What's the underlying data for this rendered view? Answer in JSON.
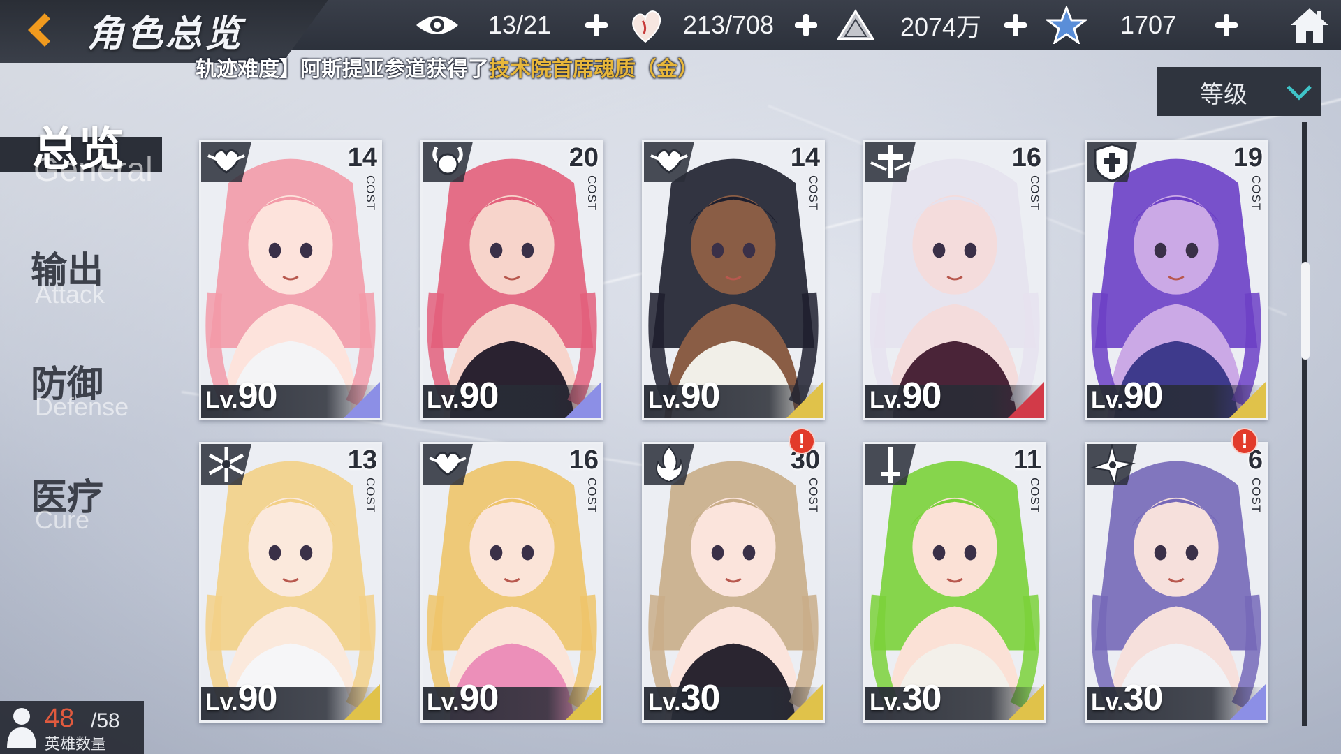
{
  "header": {
    "title": "角色总览",
    "resources": [
      {
        "icon": "eye-icon",
        "value": "13/21"
      },
      {
        "icon": "heart-flame-icon",
        "value": "213/708"
      },
      {
        "icon": "gold-pyramid-icon",
        "value": "2074万"
      },
      {
        "icon": "star-crystal-icon",
        "value": "1707"
      }
    ]
  },
  "ticker": {
    "text_prefix": "轨迹难度】阿斯提亚参道获得了",
    "highlight": "技术院首席魂质（金）"
  },
  "sort": {
    "label": "等级"
  },
  "nav": [
    {
      "cn": "总览",
      "en": "General",
      "active": true
    },
    {
      "cn": "输出",
      "en": "Attack",
      "active": false
    },
    {
      "cn": "防御",
      "en": "Defense",
      "active": false
    },
    {
      "cn": "医疗",
      "en": "Cure",
      "active": false
    }
  ],
  "cards": [
    {
      "cost": "14",
      "cost_label": "COST",
      "lv_prefix": "Lv.",
      "level": "90",
      "class_icon": "heart-wing-icon",
      "alert": "",
      "hair": "#f39aa8",
      "skin": "#fde3dc",
      "outfit": "#f4f4f6",
      "accent": "#8c8fe6"
    },
    {
      "cost": "20",
      "cost_label": "COST",
      "lv_prefix": "Lv.",
      "level": "90",
      "class_icon": "demon-horn-icon",
      "alert": "",
      "hair": "#e35f7b",
      "skin": "#f7d4cb",
      "outfit": "#2a2230",
      "accent": "#8c8fe6"
    },
    {
      "cost": "14",
      "cost_label": "COST",
      "lv_prefix": "Lv.",
      "level": "90",
      "class_icon": "heart-wing-icon",
      "alert": "",
      "hair": "#1e1f2e",
      "skin": "#8a5d45",
      "outfit": "#f1efe8",
      "accent": "#e0c24a"
    },
    {
      "cost": "16",
      "cost_label": "COST",
      "lv_prefix": "Lv.",
      "level": "90",
      "class_icon": "cross-wing-icon",
      "alert": "",
      "hair": "#e6e2ee",
      "skin": "#f4dcdc",
      "outfit": "#4a2438",
      "accent": "#d23a48"
    },
    {
      "cost": "19",
      "cost_label": "COST",
      "lv_prefix": "Lv.",
      "level": "90",
      "class_icon": "shield-cross-icon",
      "alert": "",
      "hair": "#6c3fc6",
      "skin": "#cba9e6",
      "outfit": "#3e3a8c",
      "accent": "#e0c24a"
    },
    {
      "cost": "13",
      "cost_label": "COST",
      "lv_prefix": "Lv.",
      "level": "90",
      "class_icon": "snowflake-icon",
      "alert": "",
      "hair": "#f3d087",
      "skin": "#fbe9dc",
      "outfit": "#f6f6f8",
      "accent": "#e0c24a"
    },
    {
      "cost": "16",
      "cost_label": "COST",
      "lv_prefix": "Lv.",
      "level": "90",
      "class_icon": "heart-wing-icon",
      "alert": "",
      "hair": "#eec46a",
      "skin": "#fbe4d8",
      "outfit": "#ec8fb9",
      "accent": "#e0c24a"
    },
    {
      "cost": "30",
      "cost_label": "COST",
      "lv_prefix": "Lv.",
      "level": "30",
      "class_icon": "flame-icon",
      "alert": "!",
      "hair": "#c9ad88",
      "skin": "#fbe4dc",
      "outfit": "#2a2530",
      "accent": "#e0c24a"
    },
    {
      "cost": "11",
      "cost_label": "COST",
      "lv_prefix": "Lv.",
      "level": "30",
      "class_icon": "sword-icon",
      "alert": "",
      "hair": "#7bd13a",
      "skin": "#fbe1d6",
      "outfit": "#f3f0ea",
      "accent": "#e0c24a"
    },
    {
      "cost": "6",
      "cost_label": "COST",
      "lv_prefix": "Lv.",
      "level": "30",
      "class_icon": "shuriken-icon",
      "alert": "!",
      "hair": "#7668b8",
      "skin": "#f6e0dc",
      "outfit": "#f1f1f4",
      "accent": "#8c8fe6"
    }
  ],
  "hero_count": {
    "current": "48",
    "max": "/58",
    "label": "英雄数量"
  }
}
